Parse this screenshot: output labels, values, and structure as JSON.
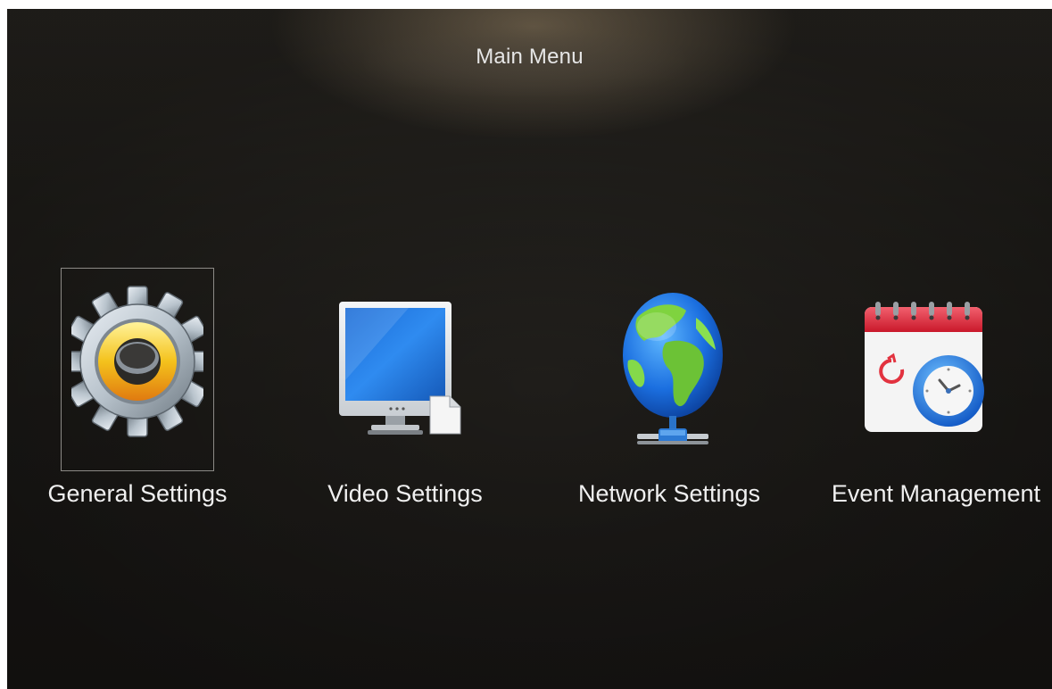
{
  "title": "Main Menu",
  "menu": {
    "items": [
      {
        "label": "General Settings",
        "icon": "gear-icon",
        "selected": true
      },
      {
        "label": "Video Settings",
        "icon": "monitor-icon",
        "selected": false
      },
      {
        "label": "Network Settings",
        "icon": "globe-network-icon",
        "selected": false
      },
      {
        "label": "Event Management",
        "icon": "calendar-clock-icon",
        "selected": false
      }
    ]
  },
  "colors": {
    "background": "#24221e",
    "text": "#f0f0f0",
    "focus_frame": "#8c8a86"
  }
}
